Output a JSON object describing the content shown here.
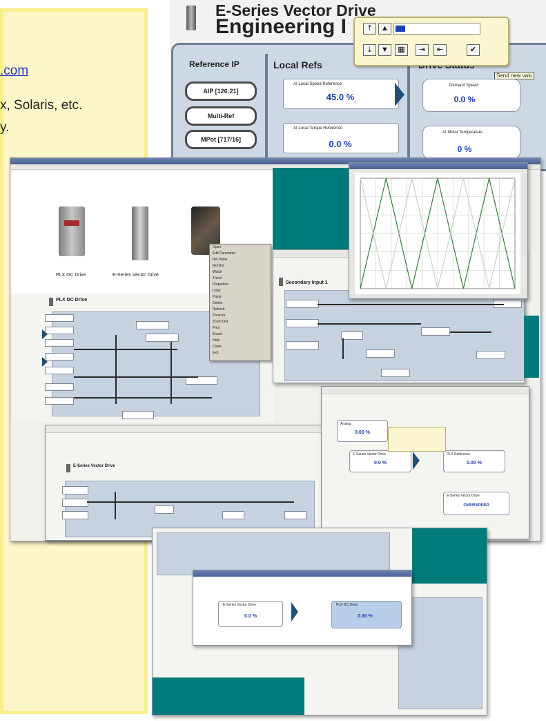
{
  "note": {
    "link_text": ".com",
    "line2": "x, Solaris, etc.",
    "line3": "y."
  },
  "engineering_window": {
    "title_line1": "E-Series Vector Drive",
    "title_line2": "Engineering I",
    "tooltip": "Send new valu",
    "sections": {
      "reference_ip": "Reference IP",
      "local_refs": "Local Refs",
      "drive_status": "Drive Status"
    },
    "ref_buttons": [
      "AIP [126:21]",
      "Multi-Ref",
      "MPot [717/16]"
    ],
    "local_refs": [
      {
        "label": "AI Local Speed Reference",
        "value": "45.0 %"
      },
      {
        "label": "AI Local Torque Reference",
        "value": "0.0 %"
      }
    ],
    "status": [
      {
        "label": "Demand Speed",
        "value": "0.0 %"
      },
      {
        "label": "AI Motor Temperature",
        "value": "0 %"
      }
    ]
  },
  "main_window": {
    "drives": [
      "PLX DC Drive",
      "E-Series Vector Drive"
    ],
    "diagram_title": "PLX DC Drive",
    "context_menu_items": [
      "Open",
      "Edit Parameter",
      "Set Value",
      "Monitor",
      "Watch",
      "Trend",
      "Properties",
      "Copy",
      "Paste",
      "Delete",
      "Refresh",
      "Zoom In",
      "Zoom Out",
      "Print",
      "Export",
      "Help",
      "Close",
      "Exit"
    ]
  },
  "secondary_window": {
    "title": "Secondary Input 1"
  },
  "monitor_window": {
    "panels": [
      {
        "label": "Analog",
        "value": "0.00 %"
      },
      {
        "label": "E-Series Vector Drive",
        "value": "0.0 %"
      },
      {
        "label": "PLX Reference",
        "value": "0.00 %"
      },
      {
        "label": "E-Series Vector Drive",
        "value": "OVERSPEED"
      }
    ]
  },
  "bottom_window": {
    "panels": [
      {
        "label": "E-Series Vector Drive",
        "value": "0.0 %"
      },
      {
        "label": "PLX DC Drive",
        "value": "0.00 %"
      }
    ]
  },
  "vector_window": {
    "title": "E-Series Vector Drive"
  },
  "chart_data": {
    "type": "line",
    "title": "",
    "xlabel": "",
    "ylabel": "",
    "grid": true,
    "series": [
      {
        "color": "#3a7a3a",
        "x": [
          0,
          1,
          2,
          3,
          4,
          5,
          6
        ],
        "values": [
          0,
          1,
          0,
          1,
          0,
          1,
          0
        ]
      },
      {
        "color": "#c8d0c8",
        "x": [
          0,
          1,
          2,
          3,
          4,
          5,
          6
        ],
        "values": [
          1,
          0,
          1,
          0,
          1,
          0,
          1
        ]
      }
    ]
  }
}
